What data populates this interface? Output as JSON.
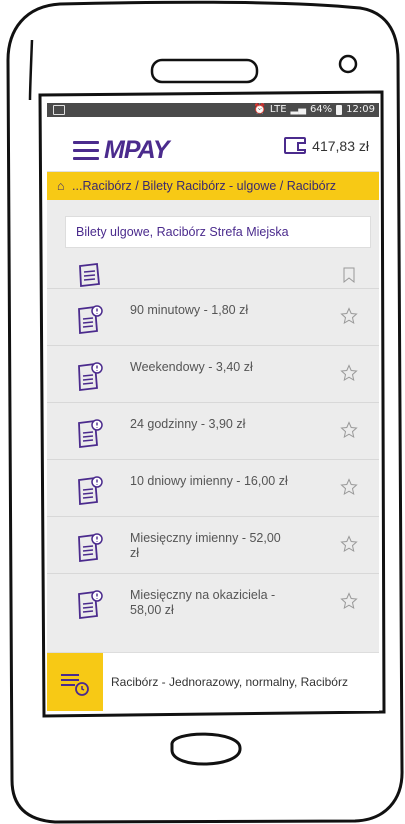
{
  "status_bar": {
    "network": "LTE",
    "battery": "64%",
    "time": "12:09"
  },
  "app_bar": {
    "logo": "MPAY",
    "balance": "417,83 zł"
  },
  "breadcrumb": {
    "path": "...Racibórz / Bilety Racibórz - ulgowe / Racibórz"
  },
  "search": {
    "value": "Bilety ulgowe, Racibórz Strefa Miejska"
  },
  "tickets": [
    {
      "label": "90 minutowy - 1,80 zł"
    },
    {
      "label": "Weekendowy - 3,40 zł"
    },
    {
      "label": "24 godzinny - 3,90 zł"
    },
    {
      "label": "10 dniowy imienny - 16,00 zł"
    },
    {
      "label": "Miesięczny imienny - 52,00 zł"
    },
    {
      "label": "Miesięczny na okaziciela - 58,00 zł"
    }
  ],
  "recent": {
    "label": "Racibórz - Jednorazowy, normalny, Racibórz"
  },
  "colors": {
    "brand_purple": "#4b2b8d",
    "accent_yellow": "#f7c915"
  }
}
